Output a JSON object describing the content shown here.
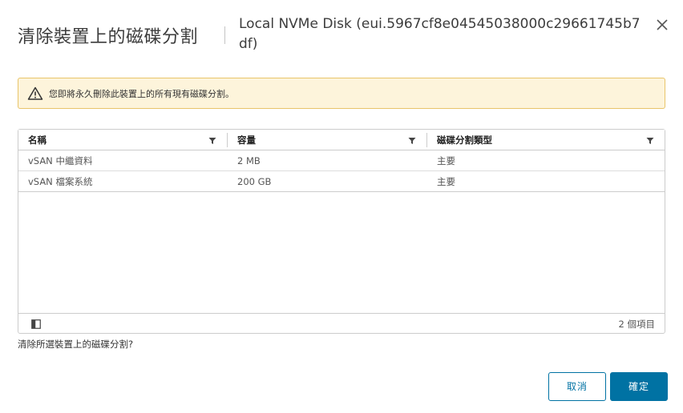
{
  "dialog": {
    "title": "清除裝置上的磁碟分割",
    "subtitle": "Local NVMe Disk (eui.5967cf8e04545038000c29661745b7df)",
    "close_icon": "close-icon"
  },
  "alert": {
    "icon": "warning-icon",
    "text": "您即將永久刪除此裝置上的所有現有磁碟分割。",
    "bg_color": "#fdf4db",
    "border_color": "#e8c46a"
  },
  "grid": {
    "columns": [
      {
        "label": "名稱"
      },
      {
        "label": "容量"
      },
      {
        "label": "磁碟分割類型"
      }
    ],
    "rows": [
      {
        "name": "vSAN 中繼資料",
        "capacity": "2 MB",
        "type": "主要"
      },
      {
        "name": "vSAN 檔案系統",
        "capacity": "200 GB",
        "type": "主要"
      }
    ],
    "footer": {
      "column_toggle_icon": "column-toggle-icon",
      "count": "2 個項目"
    }
  },
  "confirm_text": "清除所選裝置上的磁碟分割?",
  "buttons": {
    "cancel": "取消",
    "ok": "確定",
    "accent_color": "#0072a3"
  }
}
